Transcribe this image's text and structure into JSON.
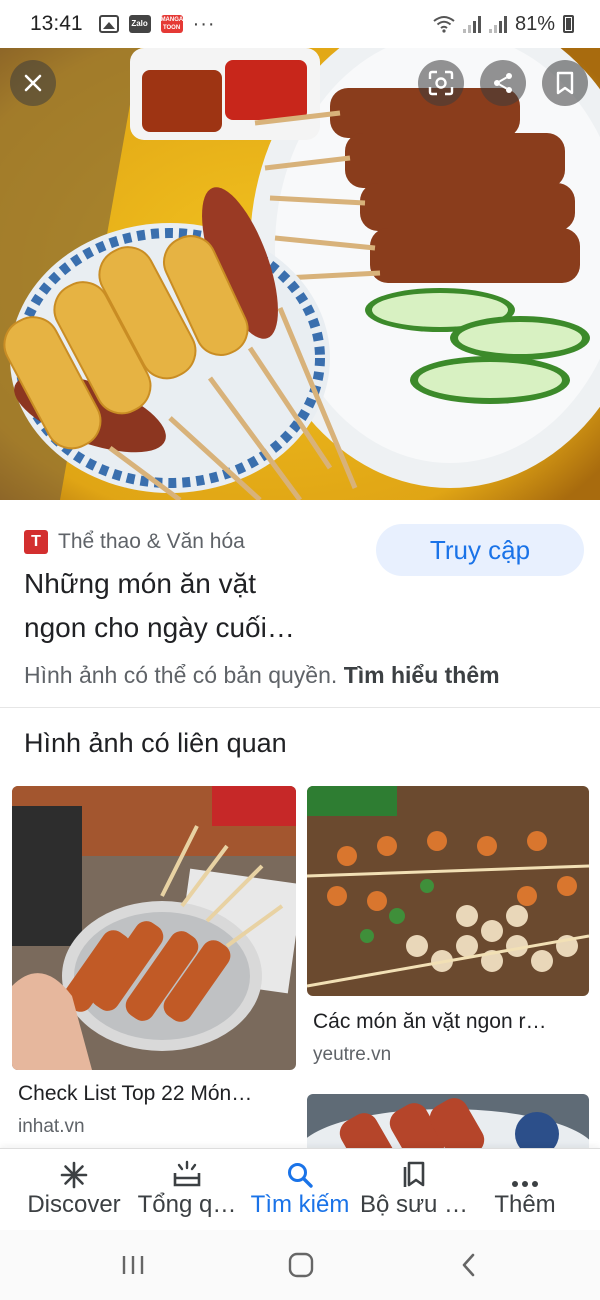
{
  "status_bar": {
    "time": "13:41",
    "app_icons": [
      "gallery-icon",
      "zalo-icon",
      "mangatoon-icon"
    ],
    "overflow": "···",
    "battery": "81%",
    "zalo_text": "Zalo",
    "manga_text": "MANGA TOON"
  },
  "viewer": {
    "close_icon": "close-icon",
    "actions": [
      "lens-icon",
      "share-icon",
      "bookmark-icon"
    ]
  },
  "result": {
    "source_name": "Thể thao & Văn hóa",
    "source_logo": "T",
    "visit_label": "Truy cập",
    "title_line1": "Những món ăn vặt",
    "title_line2": "ngon cho ngày cuối…",
    "copyright_text": "Hình ảnh có thể có bản quyền.",
    "learn_more": "Tìm hiểu thêm"
  },
  "related": {
    "heading": "Hình ảnh có liên quan",
    "items": [
      {
        "title": "Check List Top 22 Món…",
        "source": "inhat.vn"
      },
      {
        "title": "Các món ăn vặt ngon r…",
        "source": "yeutre.vn"
      },
      {
        "title": "",
        "source": ""
      }
    ]
  },
  "bottom_nav": {
    "items": [
      {
        "label": "Discover",
        "icon": "asterisk-icon"
      },
      {
        "label": "Tổng q…",
        "icon": "updates-icon"
      },
      {
        "label": "Tìm kiếm",
        "icon": "search-icon",
        "active": true
      },
      {
        "label": "Bộ sưu …",
        "icon": "collections-icon"
      },
      {
        "label": "Thêm",
        "icon": "more-icon"
      }
    ]
  },
  "colors": {
    "accent": "#1a73e8",
    "accent_bg": "#e8f0fe",
    "source_logo_bg": "#d32f2f"
  }
}
